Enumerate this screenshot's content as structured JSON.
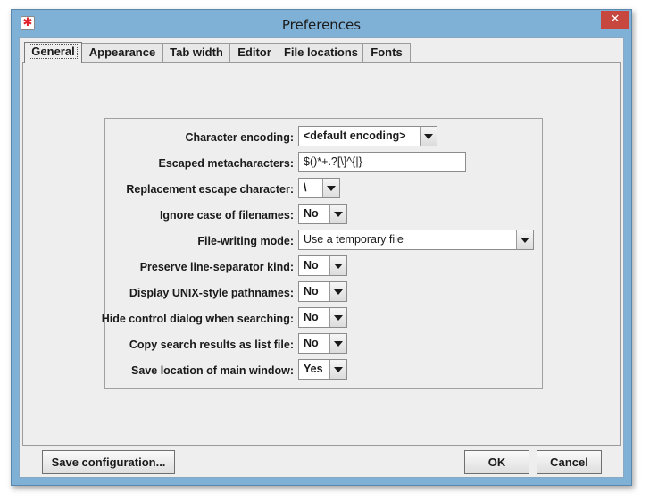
{
  "window": {
    "title": "Preferences",
    "close_glyph": "✕",
    "app_icon": "asterisk-icon"
  },
  "tabs": [
    "General",
    "Appearance",
    "Tab width",
    "Editor",
    "File locations",
    "Fonts"
  ],
  "active_tab": "General",
  "form": {
    "character_encoding": {
      "label": "Character encoding:",
      "value": "<default encoding>"
    },
    "escaped_metacharacters": {
      "label": "Escaped metacharacters:",
      "value": "$()*+.?[\\]^{|}"
    },
    "replacement_escape": {
      "label": "Replacement escape character:",
      "value": "\\"
    },
    "ignore_case": {
      "label": "Ignore case of filenames:",
      "value": "No"
    },
    "file_writing_mode": {
      "label": "File-writing mode:",
      "value": "Use a temporary file"
    },
    "preserve_line_separator": {
      "label": "Preserve line-separator kind:",
      "value": "No"
    },
    "unix_pathnames": {
      "label": "Display UNIX-style pathnames:",
      "value": "No"
    },
    "hide_control_dialog": {
      "label": "Hide control dialog when searching:",
      "value": "No"
    },
    "copy_search_results": {
      "label": "Copy search results as list file:",
      "value": "No"
    },
    "save_location": {
      "label": "Save location of main window:",
      "value": "Yes"
    }
  },
  "buttons": {
    "save_configuration": "Save configuration...",
    "ok": "OK",
    "cancel": "Cancel"
  },
  "colors": {
    "title_bar": "#7fb0d6",
    "close_button": "#c7463d",
    "panel": "#eeeeee"
  }
}
